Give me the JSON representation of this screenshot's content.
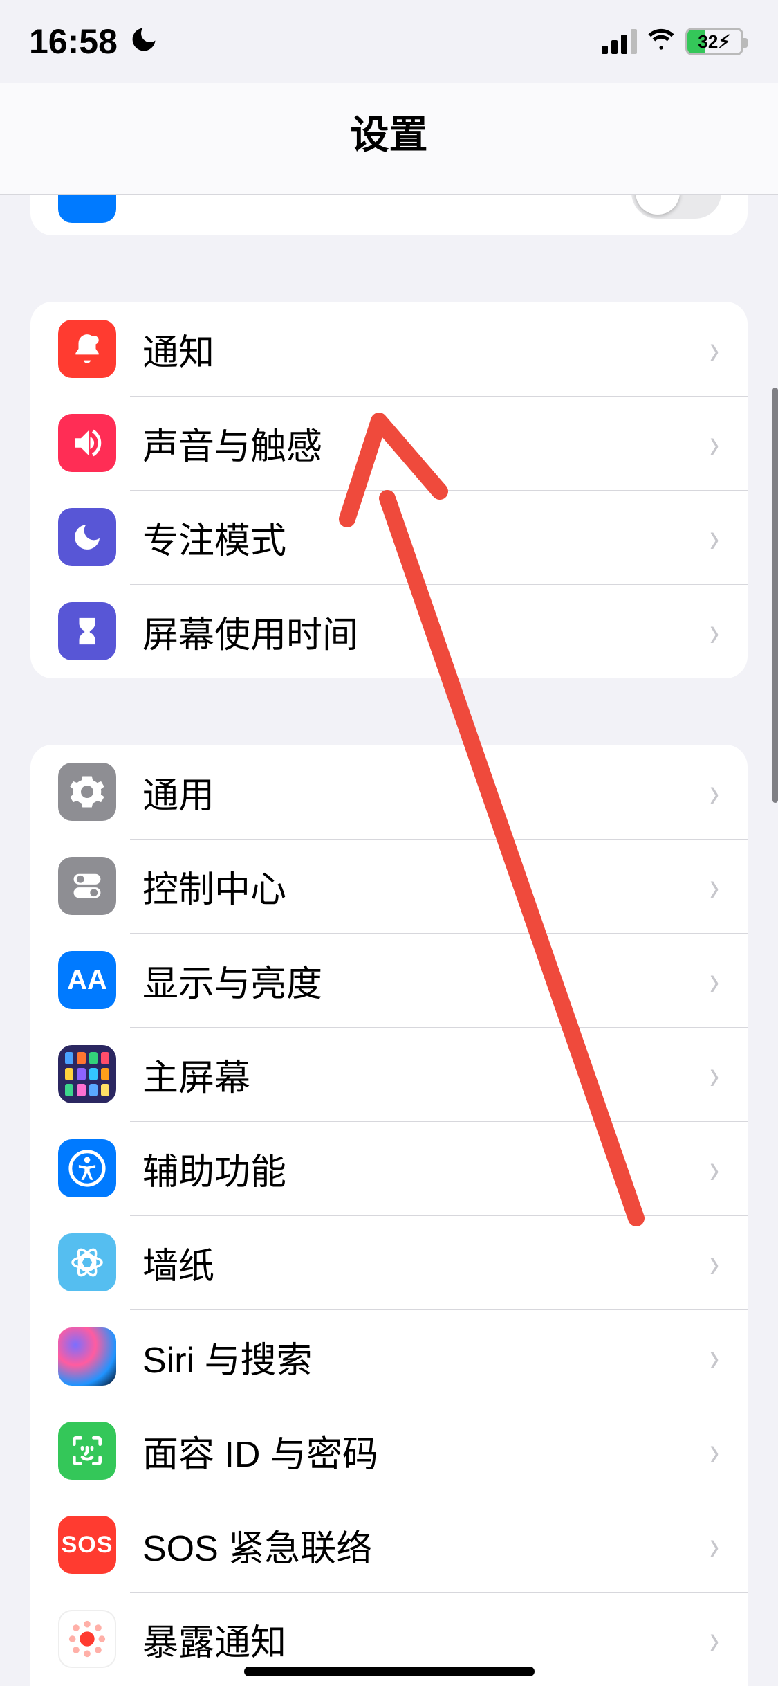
{
  "status": {
    "time": "16:58",
    "battery_text": "32⚡︎"
  },
  "header": {
    "title": "设置"
  },
  "group1": [
    {
      "label": "通知"
    },
    {
      "label": "声音与触感"
    },
    {
      "label": "专注模式"
    },
    {
      "label": "屏幕使用时间"
    }
  ],
  "group2": [
    {
      "label": "通用"
    },
    {
      "label": "控制中心"
    },
    {
      "label": "显示与亮度"
    },
    {
      "label": "主屏幕"
    },
    {
      "label": "辅助功能"
    },
    {
      "label": "墙纸"
    },
    {
      "label": "Siri 与搜索"
    },
    {
      "label": "面容 ID 与密码"
    },
    {
      "label": "SOS 紧急联络"
    },
    {
      "label": "暴露通知"
    }
  ],
  "sos_text": "SOS"
}
